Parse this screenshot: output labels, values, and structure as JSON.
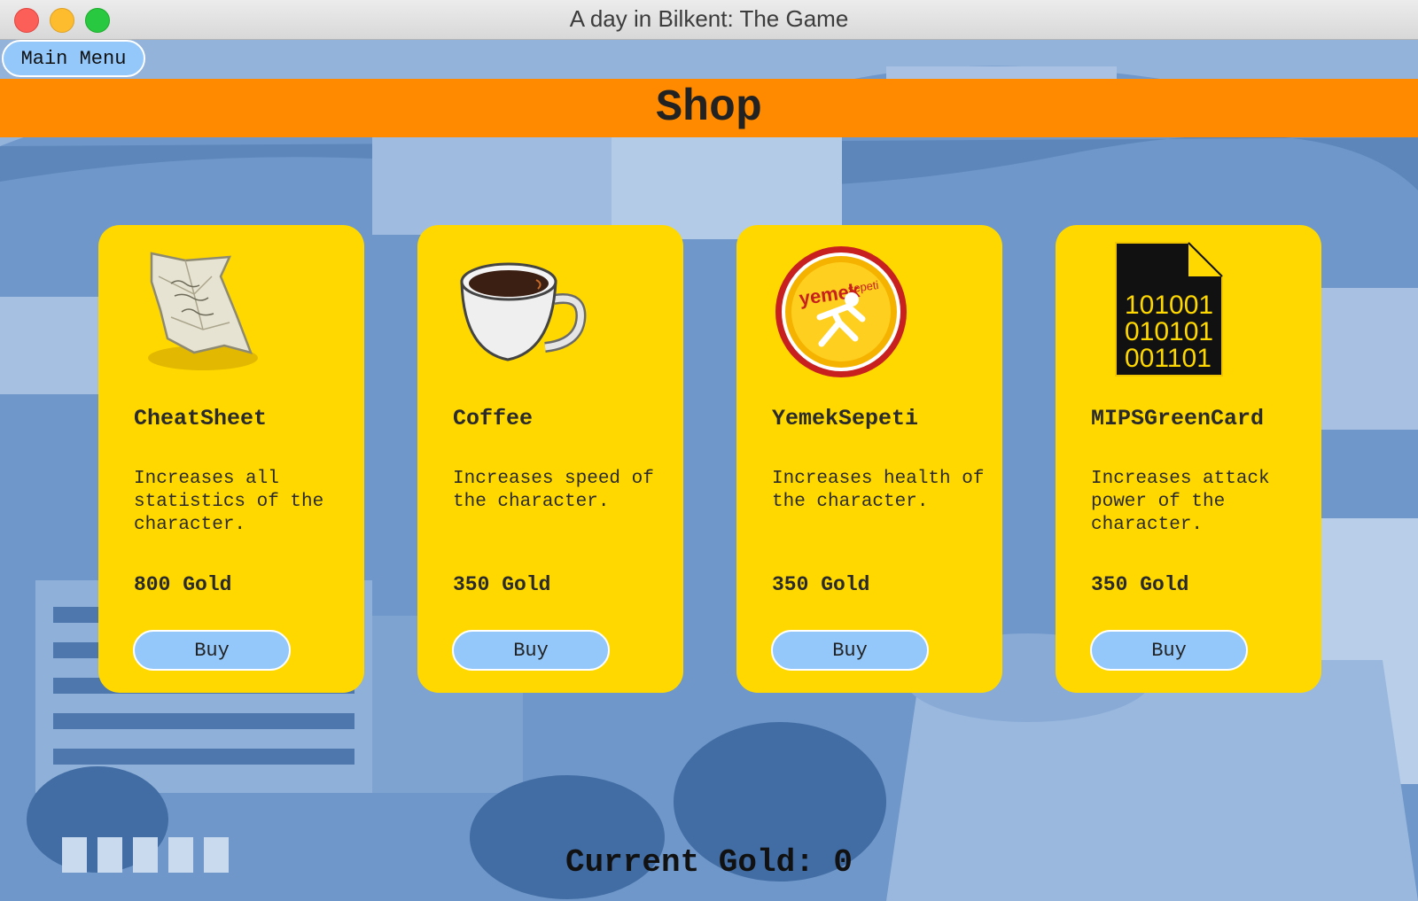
{
  "window": {
    "title": "A day in Bilkent: The Game"
  },
  "nav": {
    "main_menu_label": "Main Menu"
  },
  "header": {
    "title": "Shop"
  },
  "items": [
    {
      "name": "CheatSheet",
      "description": "Increases all statistics of the character.",
      "price": "800 Gold",
      "buy_label": "Buy",
      "icon": "crumpled-paper-icon"
    },
    {
      "name": "Coffee",
      "description": "Increases speed of the character.",
      "price": "350 Gold",
      "buy_label": "Buy",
      "icon": "coffee-cup-icon"
    },
    {
      "name": "YemekSepeti",
      "description": "Increases health of the character.",
      "price": "350 Gold",
      "buy_label": "Buy",
      "icon": "yemeksepeti-logo-icon"
    },
    {
      "name": "MIPSGreenCard",
      "description": "Increases attack power of the character.",
      "price": "350 Gold",
      "buy_label": "Buy",
      "icon": "binary-file-icon"
    }
  ],
  "icon_text": {
    "logo_word_main": "yemek",
    "logo_word_sub": "sepeti",
    "binary": [
      "101001",
      "010101",
      "001101"
    ]
  },
  "status": {
    "current_gold": "Current Gold: 0"
  },
  "colors": {
    "header": "#ff8a00",
    "card": "#ffd800",
    "button": "#94c8fb",
    "background": "#6b93c6"
  }
}
